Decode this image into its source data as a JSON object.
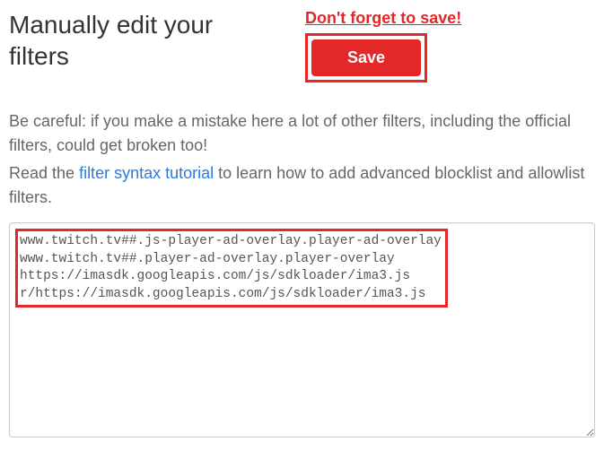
{
  "header": {
    "title": "Manually edit your filters",
    "reminder": "Don't forget to save!",
    "save_label": "Save"
  },
  "body": {
    "warning": "Be careful: if you make a mistake here a lot of other filters, including the official filters, could get broken too!",
    "read_prefix": "Read the ",
    "tutorial_link": "filter syntax tutorial",
    "read_suffix": " to learn how to add advanced blocklist and allowlist filters."
  },
  "filters": {
    "content": "www.twitch.tv##.js-player-ad-overlay.player-ad-overlay\nwww.twitch.tv##.player-ad-overlay.player-overlay\nhttps://imasdk.googleapis.com/js/sdkloader/ima3.js\nr/https://imasdk.googleapis.com/js/sdkloader/ima3.js"
  }
}
